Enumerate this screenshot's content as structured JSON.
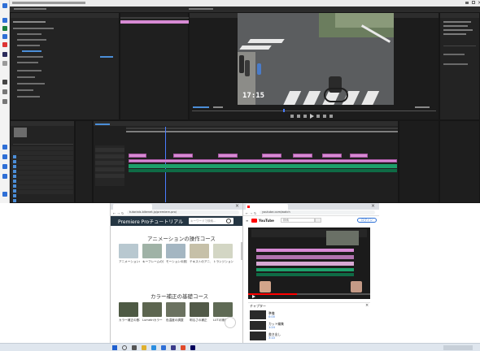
{
  "premiere": {
    "monitor": {
      "timecode": "17:15"
    }
  },
  "browser_left": {
    "url": "tutorials.bikenet.jp/premiere-pro/",
    "site_title": "Premiere Proチュートリアル",
    "search_placeholder": "キーワードで検索...",
    "sections": [
      {
        "title": "アニメーションの操作コース",
        "items": [
          {
            "label": "アニメーションの基本"
          },
          {
            "label": "キーフレームの追加"
          },
          {
            "label": "モーションの設定"
          },
          {
            "label": "テキストのアニメ"
          },
          {
            "label": "トランジション"
          }
        ]
      },
      {
        "title": "カラー補正の基礎コース",
        "items": [
          {
            "label": "カラー補正の基本"
          },
          {
            "label": "Lumetriカラー"
          },
          {
            "label": "色温度の調整"
          },
          {
            "label": "明るさの補正"
          },
          {
            "label": "LUTの適用"
          }
        ]
      }
    ]
  },
  "browser_right": {
    "url": "youtube.com/watch",
    "search_placeholder": "検索",
    "sign_in": "ログイン",
    "chapters_label": "チャプター",
    "chapters": [
      {
        "title": "準備",
        "time": "0:00"
      },
      {
        "title": "カット編集",
        "time": "1:24"
      },
      {
        "title": "書き出し",
        "time": "3:10"
      }
    ]
  },
  "icons": {
    "close": "close-icon",
    "search": "search-icon",
    "windows": "windows-start-icon"
  },
  "colors": {
    "video_clip": "#d78ad4",
    "audio_clip": "#1d9f6a",
    "playhead": "#4a7dff",
    "site_header": "#243542",
    "youtube_red": "#ff0000"
  }
}
